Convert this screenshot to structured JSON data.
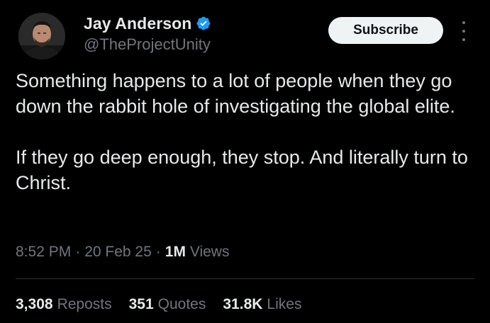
{
  "author": {
    "display_name": "Jay Anderson",
    "handle": "@TheProjectUnity",
    "verified": true
  },
  "subscribe_label": "Subscribe",
  "tweet": {
    "paragraphs": [
      "Something happens to a lot of people when they go down the rabbit hole of investigating the global elite.",
      "If they go deep enough, they stop. And literally turn to Christ."
    ],
    "time": "8:52 PM",
    "date": "20 Feb 25",
    "views_count": "1M",
    "views_label": "Views"
  },
  "stats": {
    "reposts_count": "3,308",
    "reposts_label": "Reposts",
    "quotes_count": "351",
    "quotes_label": "Quotes",
    "likes_count": "31.8K",
    "likes_label": "Likes"
  },
  "colors": {
    "background": "#000000",
    "text": "#e7e9ea",
    "muted": "#71767b",
    "verified_badge": "#1d9bf0",
    "button_bg": "#eff3f4"
  },
  "icons": [
    "verified-badge-icon",
    "more-options-icon"
  ]
}
